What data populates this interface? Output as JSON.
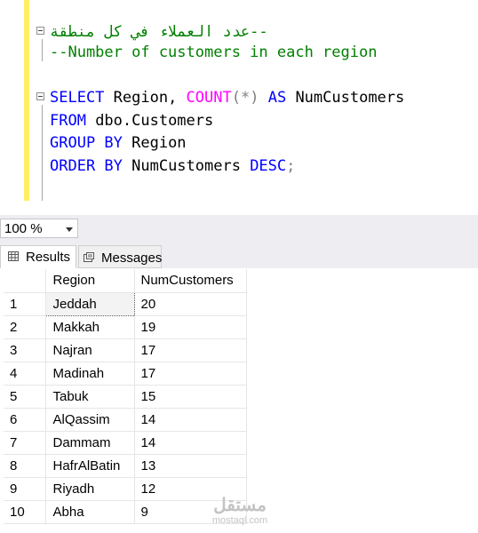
{
  "editor": {
    "lines": [
      {
        "comment": "--عدد العملاء في كل منطقة"
      },
      {
        "comment": "--Number of customers in each region"
      },
      {
        "kw1": "SELECT",
        "t1": " Region, ",
        "fn": "COUNT",
        "p1": "(",
        "star": "*",
        "p2": ")",
        "kw2": " AS",
        "t2": " NumCustomers"
      },
      {
        "kw1": "FROM",
        "t1": " dbo.Customers"
      },
      {
        "kw1": "GROUP BY",
        "t1": " Region"
      },
      {
        "kw1": "ORDER BY",
        "t1": " NumCustomers ",
        "kw2": "DESC",
        "semi": ";"
      }
    ]
  },
  "zoom": {
    "value": "100 %"
  },
  "tabs": [
    {
      "label": "Results",
      "icon": "grid-icon"
    },
    {
      "label": "Messages",
      "icon": "messages-icon"
    }
  ],
  "results": {
    "columns": [
      "",
      "Region",
      "NumCustomers"
    ],
    "rows": [
      [
        "1",
        "Jeddah",
        "20"
      ],
      [
        "2",
        "Makkah",
        "19"
      ],
      [
        "3",
        "Najran",
        "17"
      ],
      [
        "4",
        "Madinah",
        "17"
      ],
      [
        "5",
        "Tabuk",
        "15"
      ],
      [
        "6",
        "AlQassim",
        "14"
      ],
      [
        "7",
        "Dammam",
        "14"
      ],
      [
        "8",
        "HafrAlBatin",
        "13"
      ],
      [
        "9",
        "Riyadh",
        "12"
      ],
      [
        "10",
        "Abha",
        "9"
      ]
    ]
  },
  "watermark": {
    "arabic": "مستقل",
    "latin": "mostaql.com"
  }
}
